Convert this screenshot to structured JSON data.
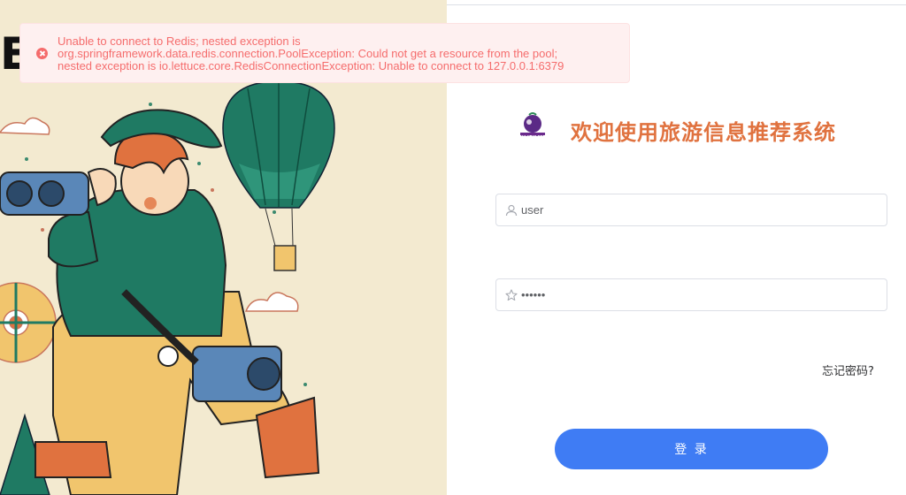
{
  "alert": {
    "line1": "Unable to connect to Redis; nested exception is",
    "line2": "org.springframework.data.redis.connection.PoolException: Could not get a resource from the pool;",
    "line3": "nested exception is io.lettuce.core.RedisConnectionException: Unable to connect to 127.0.0.1:6379",
    "icon": "error-circle-icon"
  },
  "illustration": {
    "letter": "E"
  },
  "header": {
    "logo_caption": "NEFRUIT",
    "title": "欢迎使用旅游信息推荐系统"
  },
  "form": {
    "username": {
      "value": "user",
      "icon": "user-icon"
    },
    "password": {
      "value": "••••••",
      "icon": "star-icon"
    },
    "forgot_label": "忘记密码?",
    "login_label": "登 录"
  },
  "colors": {
    "accent": "#3f7cf4",
    "title": "#e0723f",
    "error": "#f56c6c",
    "panel_bg": "#f3ead0"
  }
}
